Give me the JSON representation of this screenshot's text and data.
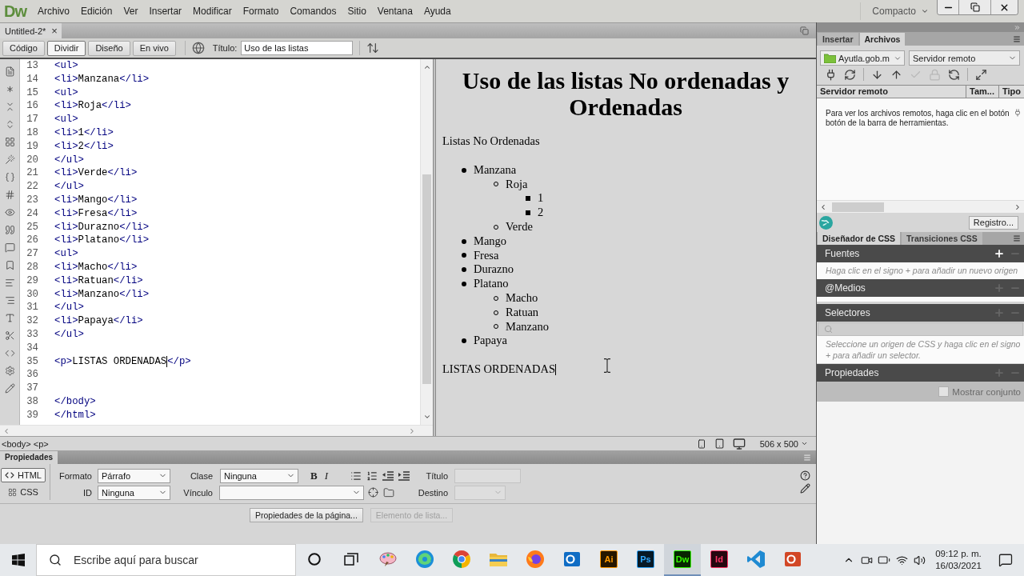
{
  "app": {
    "logo": "Dw",
    "menu": [
      "Archivo",
      "Edición",
      "Ver",
      "Insertar",
      "Modificar",
      "Formato",
      "Comandos",
      "Sitio",
      "Ventana",
      "Ayuda"
    ],
    "workspace": "Compacto"
  },
  "document_tabs": [
    {
      "title": "Untitled-2*",
      "close": "×",
      "selected": true
    }
  ],
  "toolbar": {
    "views": [
      {
        "label": "Código",
        "selected": false
      },
      {
        "label": "Dividir",
        "selected": true
      },
      {
        "label": "Diseño",
        "selected": false
      },
      {
        "label": "En vivo",
        "selected": false
      }
    ],
    "title_label": "Título:",
    "title_value": "Uso de las listas"
  },
  "code_view": {
    "lines": [
      {
        "number": "13",
        "code": "<ul>",
        "caret": false
      },
      {
        "number": "14",
        "code": "<li>Manzana</li>",
        "caret": false
      },
      {
        "number": "15",
        "code": "<ul>",
        "caret": false
      },
      {
        "number": "16",
        "code": "<li>Roja</li>",
        "caret": false
      },
      {
        "number": "17",
        "code": "<ul>",
        "caret": false
      },
      {
        "number": "18",
        "code": "<li>1</li>",
        "caret": false
      },
      {
        "number": "19",
        "code": "<li>2</li>",
        "caret": false
      },
      {
        "number": "20",
        "code": "</ul>",
        "caret": false
      },
      {
        "number": "21",
        "code": "<li>Verde</li>",
        "caret": false
      },
      {
        "number": "22",
        "code": "</ul>",
        "caret": false
      },
      {
        "number": "23",
        "code": "<li>Mango</li>",
        "caret": false
      },
      {
        "number": "24",
        "code": "<li>Fresa</li>",
        "caret": false
      },
      {
        "number": "25",
        "code": "<li>Durazno</li>",
        "caret": false
      },
      {
        "number": "26",
        "code": "<li>Platano</li>",
        "caret": false
      },
      {
        "number": "27",
        "code": "<ul>",
        "caret": false
      },
      {
        "number": "28",
        "code": "<li>Macho</li>",
        "caret": false
      },
      {
        "number": "29",
        "code": "<li>Ratuan</li>",
        "caret": false
      },
      {
        "number": "30",
        "code": "<li>Manzano</li>",
        "caret": false
      },
      {
        "number": "31",
        "code": "</ul>",
        "caret": false
      },
      {
        "number": "32",
        "code": "<li>Papaya</li>",
        "caret": false
      },
      {
        "number": "33",
        "code": "</ul>",
        "caret": false
      },
      {
        "number": "34"
      },
      {
        "number": "35",
        "code": "<p>LISTAS ORDENADAS</p>",
        "caret": true
      },
      {
        "number": "36"
      },
      {
        "number": "37"
      },
      {
        "number": "38",
        "code": "</body>",
        "caret": false
      },
      {
        "number": "39",
        "code": "</html>",
        "caret": false
      }
    ]
  },
  "design_view": {
    "heading": "Uso de las listas No ordenadas y Ordenadas",
    "blocks": [
      {
        "kind": "paragraph",
        "text": "Listas No Ordenadas",
        "caret": false
      },
      {
        "kind": "list",
        "items": [
          {
            "text": "Manzana",
            "children": [
              {
                "text": "Roja",
                "children": [
                  {
                    "text": "1"
                  },
                  {
                    "text": "2"
                  }
                ]
              },
              {
                "text": "Verde"
              }
            ]
          },
          {
            "text": "Mango"
          },
          {
            "text": "Fresa"
          },
          {
            "text": "Durazno"
          },
          {
            "text": "Platano",
            "children": [
              {
                "text": "Macho"
              },
              {
                "text": "Ratuan"
              },
              {
                "text": "Manzano"
              }
            ]
          },
          {
            "text": "Papaya"
          }
        ]
      },
      {
        "kind": "paragraph",
        "text": "LISTAS ORDENADAS",
        "caret": true
      }
    ]
  },
  "status_bar": {
    "tag_selector": "<body> <p>",
    "window_size": "506 x 500"
  },
  "properties": {
    "tab": "Propiedades",
    "modes": [
      {
        "label": "HTML",
        "selected": true
      },
      {
        "label": "CSS",
        "selected": false
      }
    ],
    "format": {
      "label": "Formato",
      "value": "Párrafo"
    },
    "id": {
      "label": "ID",
      "value": "Ninguna"
    },
    "class": {
      "label": "Clase",
      "value": "Ninguna"
    },
    "link": {
      "label": "Vínculo"
    },
    "text_styles": [
      {
        "kind": "bold",
        "label": "B"
      },
      {
        "kind": "italic",
        "label": "I"
      }
    ],
    "title": {
      "label": "Título",
      "disabled": true
    },
    "target": {
      "label": "Destino",
      "disabled": true
    },
    "buttons": [
      {
        "label": "Propiedades de la página...",
        "disabled": false
      },
      {
        "label": "Elemento de lista...",
        "disabled": true
      }
    ]
  },
  "files_panel": {
    "tabs": [
      {
        "label": "Insertar",
        "selected": false
      },
      {
        "label": "Archivos",
        "selected": true
      }
    ],
    "site": "Ayutla.gob.m",
    "view": "Servidor remoto",
    "toolbar": [
      {
        "kind": "connect",
        "disabled": false
      },
      {
        "kind": "refresh",
        "disabled": false
      },
      {
        "kind": "get",
        "disabled": false
      },
      {
        "kind": "put",
        "disabled": false
      },
      {
        "kind": "check-out",
        "disabled": true
      },
      {
        "kind": "check-in",
        "disabled": true
      },
      {
        "kind": "sync",
        "disabled": false
      },
      {
        "kind": "expand",
        "disabled": false
      }
    ],
    "columns": [
      "Servidor remoto",
      "Tam...",
      "Tipo"
    ],
    "message": "Para ver los archivos remotos, haga clic en el botón botón de la barra de herramientas.",
    "log_button": "Registro..."
  },
  "css_designer": {
    "tabs": [
      {
        "label": "Diseñador de CSS",
        "selected": true
      },
      {
        "label": "Transiciones CSS",
        "selected": false
      }
    ],
    "sections": [
      {
        "kind": "sources",
        "title": "Fuentes",
        "add_enabled": true,
        "hint": "Haga clic en el signo + para añadir un nuevo origen"
      },
      {
        "kind": "media",
        "title": "@Medios",
        "add_enabled": false
      },
      {
        "kind": "selectors",
        "title": "Selectores",
        "add_enabled": false,
        "hint": "Seleccione un origen de CSS y haga clic en el signo + para añadir un selector."
      },
      {
        "kind": "properties",
        "title": "Propiedades",
        "add_enabled": false,
        "option": {
          "label": "Mostrar conjunto",
          "checked": false
        }
      }
    ]
  },
  "taskbar": {
    "search_placeholder": "Escribe aquí para buscar",
    "apps": [
      {
        "kind": "circle",
        "selected": false
      },
      {
        "kind": "frames",
        "selected": false
      },
      {
        "kind": "palette",
        "selected": false
      },
      {
        "kind": "swirl",
        "selected": false
      },
      {
        "kind": "segmented-circle",
        "selected": false
      },
      {
        "kind": "folder",
        "selected": false
      },
      {
        "kind": "flame-circle",
        "selected": false
      },
      {
        "kind": "ring-tile",
        "color": "#0f6cc4",
        "selected": false
      },
      {
        "kind": "letter-tile",
        "label": "Ai",
        "color": "#ff9a00",
        "selected": false
      },
      {
        "kind": "letter-tile",
        "label": "Ps",
        "color": "#31a8ff",
        "selected": false
      },
      {
        "kind": "letter-tile",
        "label": "Dw",
        "color": "#35fa00",
        "selected": true
      },
      {
        "kind": "letter-tile",
        "label": "Id",
        "color": "#ff3366",
        "selected": false
      },
      {
        "kind": "ribbon",
        "selected": false
      },
      {
        "kind": "ring-tile",
        "color": "#d24726",
        "selected": false
      }
    ],
    "time": "09:12 p. m.",
    "date": "16/03/2021"
  }
}
